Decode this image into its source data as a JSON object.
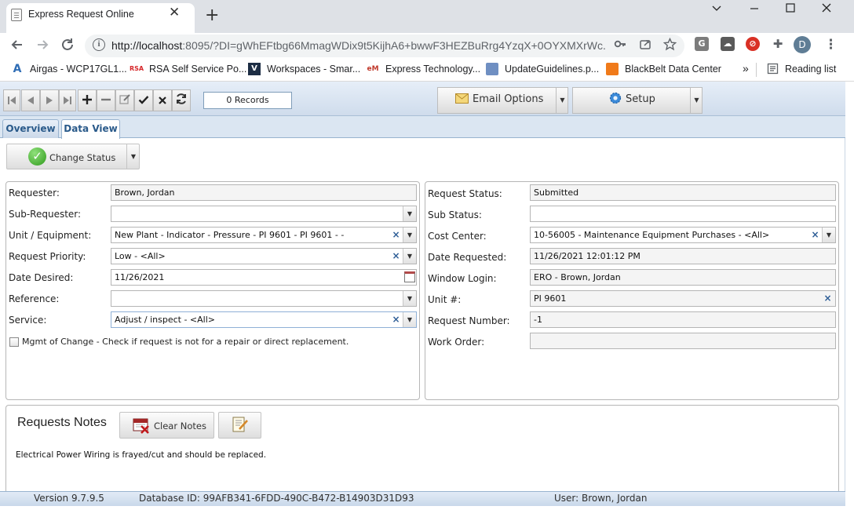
{
  "browser": {
    "tab_title": "Express Request Online",
    "tab_close": "✕",
    "new_tab": "+",
    "url_host": "http://localhost",
    "url_rest": ":8095/?DI=gWhEFtbg66MmagWDix9t5KijhA6+bwwF3HEZBuRrg4YzqX+0OYXMXrWc...",
    "bookmarks": [
      {
        "label": "Airgas - WCP17GL1...",
        "icon": "A"
      },
      {
        "label": "RSA Self Service Po...",
        "icon": "RSA"
      },
      {
        "label": "Workspaces - Smar...",
        "icon": "V"
      },
      {
        "label": "Express Technology...",
        "icon": "eM"
      },
      {
        "label": "UpdateGuidelines.p...",
        "icon": "doc"
      },
      {
        "label": "BlackBelt Data Center",
        "icon": "bb"
      }
    ],
    "bookmarks_overflow": "»",
    "reading_list": "Reading list",
    "profile_initial": "D",
    "ext_g": "G"
  },
  "app": {
    "records": "0 Records",
    "email_options": "Email Options",
    "setup": "Setup",
    "tabs": {
      "overview": "Overview",
      "data_view": "Data View"
    },
    "change_status": "Change Status",
    "left_form": {
      "requester": {
        "label": "Requester:",
        "value": "Brown, Jordan"
      },
      "sub_requester": {
        "label": "Sub-Requester:",
        "value": ""
      },
      "unit_equipment": {
        "label": "Unit / Equipment:",
        "value": "New Plant - Indicator - Pressure - PI 9601 - PI 9601 -  -"
      },
      "request_priority": {
        "label": "Request Priority:",
        "value": "Low - <All>"
      },
      "date_desired": {
        "label": "Date Desired:",
        "value": "11/26/2021"
      },
      "reference": {
        "label": "Reference:",
        "value": ""
      },
      "service": {
        "label": "Service:",
        "value": "Adjust / inspect - <All>"
      },
      "mgmt_of_change": "Mgmt of Change - Check if request is not for a repair or direct replacement."
    },
    "right_form": {
      "request_status": {
        "label": "Request Status:",
        "value": "Submitted"
      },
      "sub_status": {
        "label": "Sub Status:",
        "value": ""
      },
      "cost_center": {
        "label": "Cost Center:",
        "value": "10-56005 - Maintenance Equipment Purchases - <All>"
      },
      "date_requested": {
        "label": "Date Requested:",
        "value": "11/26/2021 12:01:12 PM"
      },
      "window_login": {
        "label": "Window Login:",
        "value": "ERO - Brown, Jordan"
      },
      "unit_no": {
        "label": "Unit #:",
        "value": "PI 9601"
      },
      "request_number": {
        "label": "Request Number:",
        "value": "-1"
      },
      "work_order": {
        "label": "Work Order:",
        "value": ""
      }
    },
    "notes": {
      "title": "Requests Notes",
      "clear_notes": "Clear Notes",
      "text": "Electrical Power Wiring is frayed/cut and should be replaced."
    },
    "status": {
      "version": "Version 9.7.9.5",
      "database_id": "Database ID: 99AFB341-6FDD-490C-B472-B14903D31D93",
      "user": "User: Brown, Jordan"
    }
  }
}
